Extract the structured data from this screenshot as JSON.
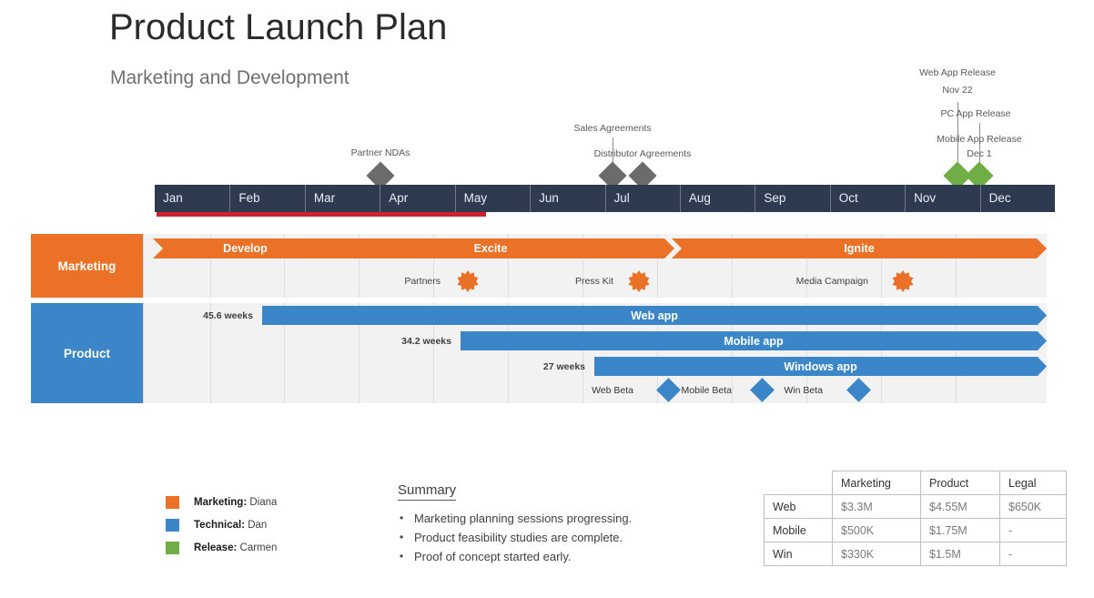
{
  "header": {
    "title": "Product Launch Plan",
    "subtitle": "Marketing and Development"
  },
  "timeline": {
    "months": [
      "Jan",
      "Feb",
      "Mar",
      "Apr",
      "May",
      "Jun",
      "Jul",
      "Aug",
      "Sep",
      "Oct",
      "Nov",
      "Dec"
    ],
    "progress_percent": 37,
    "axis_color": "#2e3a4f",
    "progress_color": "#cf2030"
  },
  "milestones": [
    {
      "label": "Partner NDAs",
      "date": "",
      "color": "#6b6b6b",
      "month": "Apr"
    },
    {
      "label": "Sales Agreements",
      "date": "",
      "color": "#6b6b6b",
      "month": "Jul"
    },
    {
      "label": "Distributor Agreements",
      "date": "",
      "color": "#6b6b6b",
      "month": "Jul"
    },
    {
      "label": "Web App Release",
      "date": "Nov 22",
      "color": "#70ad47",
      "month": "Nov"
    },
    {
      "label": "PC App Release",
      "date": "",
      "color": "#70ad47",
      "month": "Nov"
    },
    {
      "label": "Mobile App Release",
      "date": "Dec 1",
      "color": "#70ad47",
      "month": "Dec"
    }
  ],
  "lanes": [
    {
      "name": "Marketing",
      "color": "#ea7125",
      "phases": [
        {
          "label": "Develop"
        },
        {
          "label": "Excite"
        },
        {
          "label": "Ignite"
        }
      ],
      "markers": [
        {
          "label": "Partners"
        },
        {
          "label": "Press Kit"
        },
        {
          "label": "Media Campaign"
        }
      ]
    },
    {
      "name": "Product",
      "color": "#3b86c8",
      "bars": [
        {
          "label": "Web app",
          "duration": "45.6 weeks"
        },
        {
          "label": "Mobile app",
          "duration": "34.2 weeks"
        },
        {
          "label": "Windows app",
          "duration": "27 weeks"
        }
      ],
      "markers": [
        {
          "label": "Web Beta"
        },
        {
          "label": "Mobile Beta"
        },
        {
          "label": "Win Beta"
        }
      ]
    }
  ],
  "legend": [
    {
      "role": "Marketing:",
      "owner": "Diana",
      "color": "#ea7125"
    },
    {
      "role": "Technical:",
      "owner": "Dan",
      "color": "#3b86c8"
    },
    {
      "role": "Release:",
      "owner": "Carmen",
      "color": "#70ad47"
    }
  ],
  "summary": {
    "heading": "Summary",
    "bullets": [
      "Marketing planning sessions progressing.",
      "Product feasibility studies are complete.",
      "Proof of concept started early."
    ]
  },
  "budget_table": {
    "corner": "",
    "columns": [
      "Marketing",
      "Product",
      "Legal"
    ],
    "rows": [
      {
        "label": "Web",
        "values": [
          "$3.3M",
          "$4.55M",
          "$650K"
        ]
      },
      {
        "label": "Mobile",
        "values": [
          "$500K",
          "$1.75M",
          "-"
        ]
      },
      {
        "label": "Win",
        "values": [
          "$330K",
          "$1.5M",
          "-"
        ]
      }
    ]
  }
}
